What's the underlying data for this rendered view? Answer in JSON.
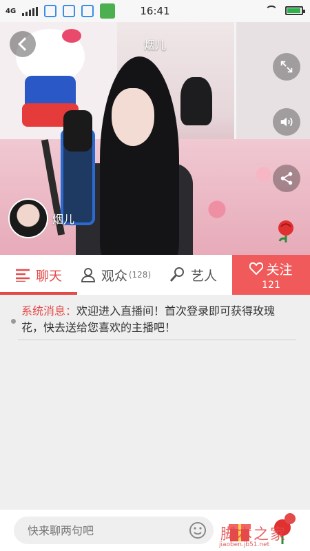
{
  "status_bar": {
    "network": "4G",
    "time": "16:41",
    "battery_level": 0.85
  },
  "live": {
    "room_name": "烟儿",
    "host_name": "烟儿"
  },
  "tabs": {
    "chat": "聊天",
    "audience": "观众",
    "audience_count": "(128)",
    "artist": "艺人",
    "follow": "关注",
    "follow_count": "121"
  },
  "messages": [
    {
      "label": "系统消息：",
      "text": "欢迎进入直播间！首次登录即可获得玫瑰花，快去送给您喜欢的主播吧！"
    }
  ],
  "input": {
    "placeholder": "快来聊两句吧"
  },
  "watermark": {
    "main": "脚本之家",
    "sub": "jiaoben.jb51.net"
  },
  "colors": {
    "accent": "#e44a4a",
    "follow_bg": "#f05a5a"
  },
  "icons": [
    "back-icon",
    "fullscreen-icon",
    "volume-icon",
    "share-icon",
    "rose-icon",
    "chat-list-icon",
    "audience-icon",
    "artist-mic-icon",
    "heart-icon",
    "emoji-icon",
    "gift-icon"
  ]
}
